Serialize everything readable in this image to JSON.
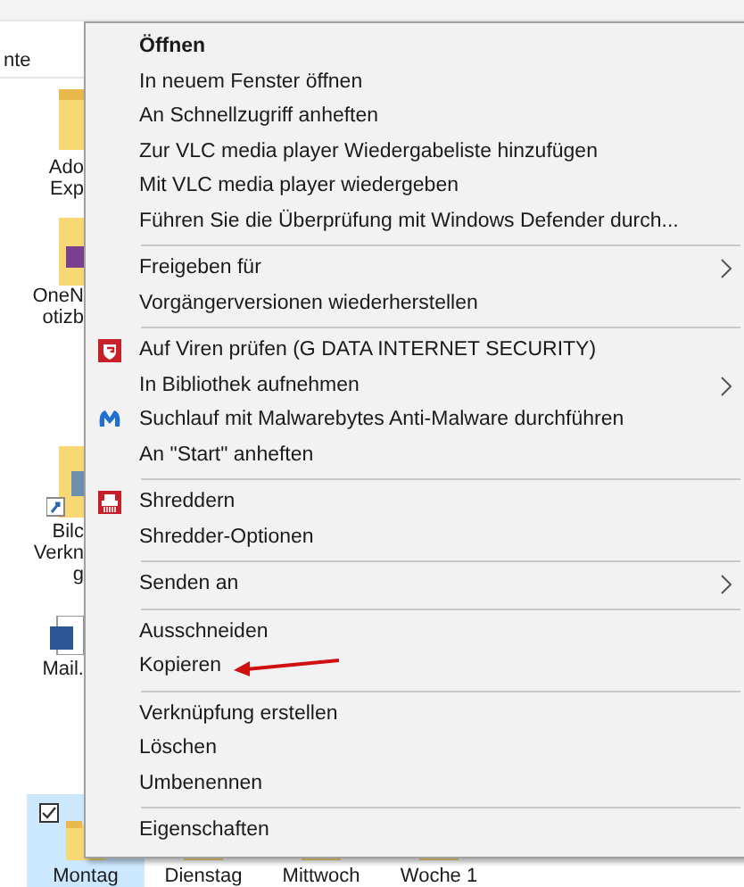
{
  "explorer": {
    "header": "nte",
    "side_items": [
      {
        "kind": "folder",
        "lines": [
          "Ado",
          "Exp"
        ]
      },
      {
        "kind": "onenote",
        "lines": [
          "OneN",
          "otizb"
        ]
      },
      {
        "kind": "shortcut",
        "lines": [
          "Bilc",
          "Verkn",
          "g"
        ]
      },
      {
        "kind": "word",
        "lines": [
          "Mail."
        ]
      }
    ],
    "bottom_items": [
      {
        "label": "Montag",
        "selected": true
      },
      {
        "label": "Dienstag",
        "selected": false
      },
      {
        "label": "Mittwoch",
        "selected": false
      },
      {
        "label": "Woche 1",
        "selected": false
      }
    ]
  },
  "context_menu": {
    "groups": [
      [
        {
          "label": "Öffnen",
          "default": true,
          "submenu": false
        },
        {
          "label": "In neuem Fenster öffnen",
          "default": false,
          "submenu": false
        },
        {
          "label": "An Schnellzugriff anheften",
          "default": false,
          "submenu": false
        },
        {
          "label": "Zur VLC media player Wiedergabeliste hinzufügen",
          "default": false,
          "submenu": false
        },
        {
          "label": "Mit VLC media player wiedergeben",
          "default": false,
          "submenu": false
        },
        {
          "label": "Führen Sie die Überprüfung mit Windows Defender durch...",
          "default": false,
          "submenu": false
        }
      ],
      [
        {
          "label": "Freigeben für",
          "default": false,
          "submenu": true
        },
        {
          "label": "Vorgängerversionen wiederherstellen",
          "default": false,
          "submenu": false
        }
      ],
      [
        {
          "label": "Auf Viren prüfen (G DATA INTERNET SECURITY)",
          "default": false,
          "submenu": false,
          "kind": "shield"
        },
        {
          "label": "In Bibliothek aufnehmen",
          "default": false,
          "submenu": true
        },
        {
          "label": "Suchlauf mit Malwarebytes Anti-Malware durchführen",
          "default": false,
          "submenu": false,
          "kind": "mlogo"
        },
        {
          "label": "An \"Start\" anheften",
          "default": false,
          "submenu": false
        }
      ],
      [
        {
          "label": "Shreddern",
          "default": false,
          "submenu": false,
          "kind": "shredder"
        },
        {
          "label": "Shredder-Optionen",
          "default": false,
          "submenu": false
        }
      ],
      [
        {
          "label": "Senden an",
          "default": false,
          "submenu": true
        }
      ],
      [
        {
          "label": "Ausschneiden",
          "default": false,
          "submenu": false
        },
        {
          "label": "Kopieren",
          "default": false,
          "submenu": false,
          "arrow": true
        }
      ],
      [
        {
          "label": "Verknüpfung erstellen",
          "default": false,
          "submenu": false
        },
        {
          "label": "Löschen",
          "default": false,
          "submenu": false
        },
        {
          "label": "Umbenennen",
          "default": false,
          "submenu": false
        }
      ],
      [
        {
          "label": "Eigenschaften",
          "default": false,
          "submenu": false
        }
      ]
    ]
  }
}
